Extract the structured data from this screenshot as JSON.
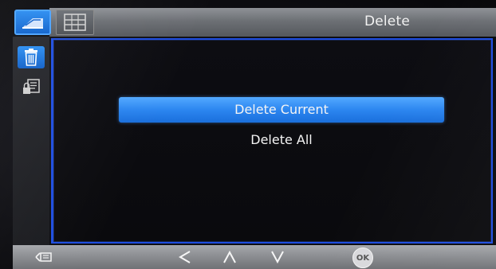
{
  "header": {
    "title": "Delete"
  },
  "mode_tabs": [
    {
      "icon": "playback-icon",
      "active": true
    },
    {
      "icon": "settings-menu-icon",
      "active": false
    }
  ],
  "sidebar": {
    "items": [
      {
        "icon": "trash-icon",
        "active": true
      },
      {
        "icon": "protect-icon",
        "active": false
      }
    ]
  },
  "menu": {
    "items": [
      {
        "label": "Delete Current",
        "selected": true
      },
      {
        "label": "Delete All",
        "selected": false
      }
    ]
  },
  "bottom_bar": {
    "ok_label": "OK",
    "buttons": [
      "back-icon",
      "left-arrow-icon",
      "up-arrow-icon",
      "down-arrow-icon",
      "ok-icon"
    ]
  },
  "colors": {
    "accent": "#2c86f0",
    "panel_border": "#1e4de0",
    "header_bg": "#6d7075",
    "text": "#f4f4f4"
  }
}
